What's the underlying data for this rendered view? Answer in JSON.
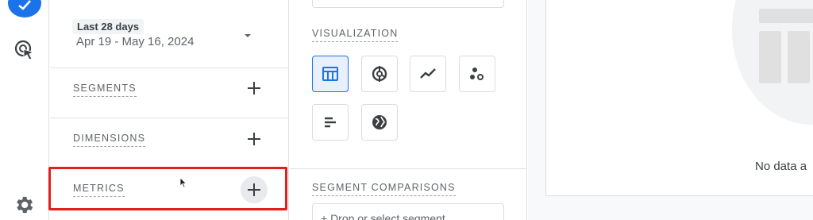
{
  "date": {
    "preset_label": "Last 28 days",
    "range_text": "Apr 19 - May 16, 2024"
  },
  "sections": {
    "segments_label": "SEGMENTS",
    "dimensions_label": "DIMENSIONS",
    "metrics_label": "METRICS"
  },
  "settings": {
    "visualization_label": "VISUALIZATION",
    "segment_comparisons_label": "SEGMENT COMPARISONS",
    "segment_drop_text": "+ Drop or select segment"
  },
  "visualizations": [
    {
      "icon": "table-icon",
      "selected": true
    },
    {
      "icon": "donut-chart-icon",
      "selected": false
    },
    {
      "icon": "line-chart-icon",
      "selected": false
    },
    {
      "icon": "scatter-plot-icon",
      "selected": false
    },
    {
      "icon": "bar-chart-icon",
      "selected": false
    },
    {
      "icon": "geo-map-icon",
      "selected": false
    }
  ],
  "canvas": {
    "no_data_text": "No data a"
  },
  "colors": {
    "accent": "#1a73e8",
    "highlight": "#e0201e",
    "icon": "#3c4043"
  }
}
